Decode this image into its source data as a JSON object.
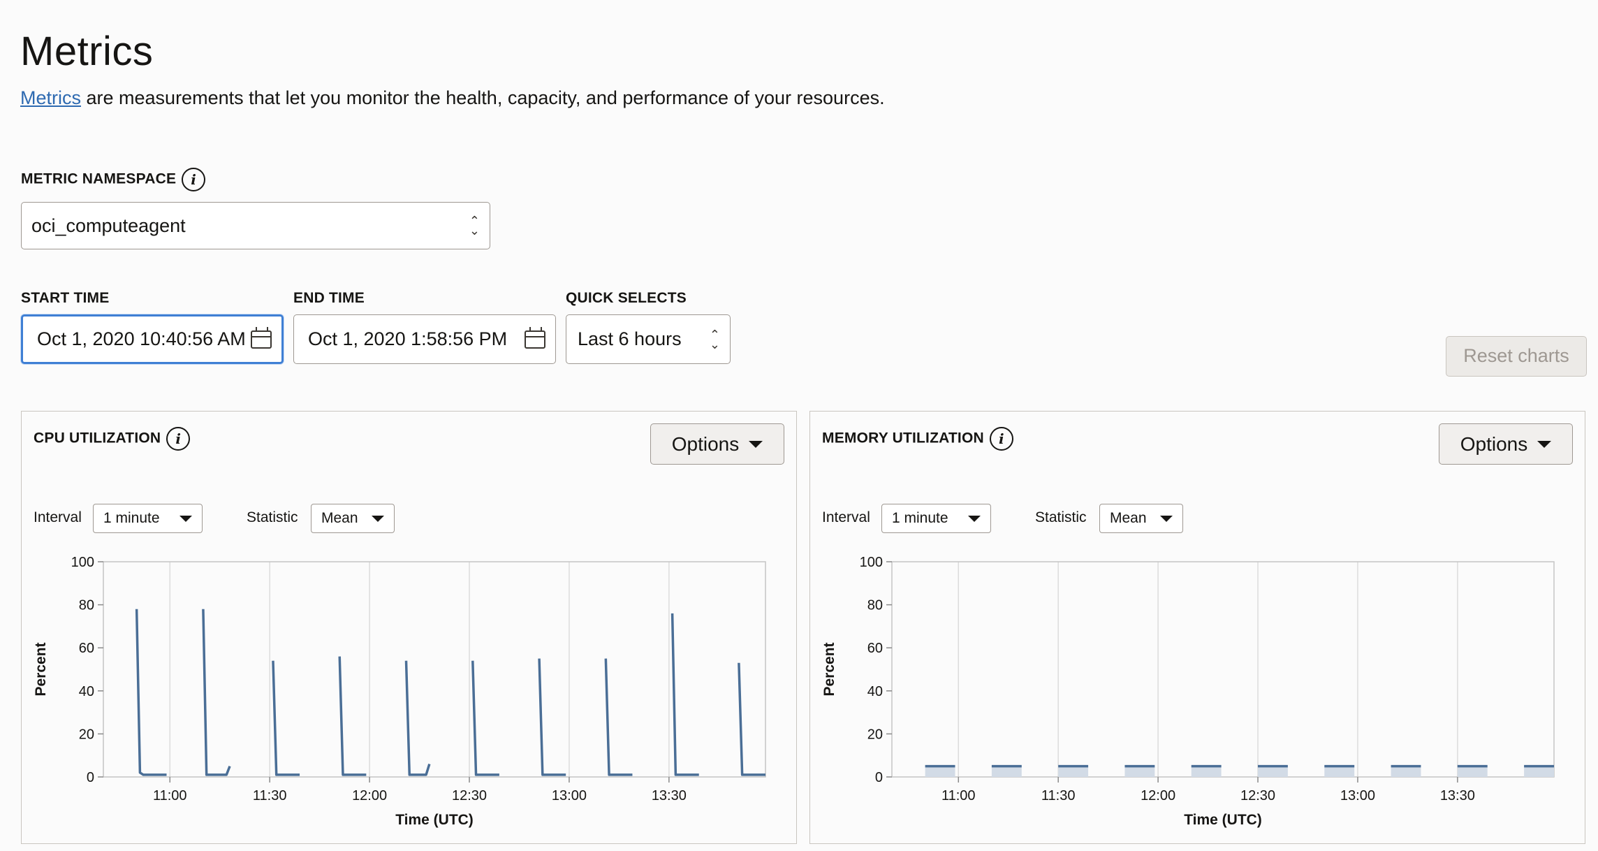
{
  "header": {
    "title": "Metrics",
    "intro_link": "Metrics",
    "intro_rest": " are measurements that let you monitor the health, capacity, and performance of your resources."
  },
  "namespace": {
    "label": "METRIC NAMESPACE",
    "value": "oci_computeagent"
  },
  "time": {
    "start_label": "START TIME",
    "start_value": "Oct 1, 2020 10:40:56 AM",
    "end_label": "END TIME",
    "end_value": "Oct 1, 2020 1:58:56 PM",
    "quick_label": "QUICK SELECTS",
    "quick_value": "Last 6 hours"
  },
  "reset_label": "Reset charts",
  "icons": [
    "info-icon",
    "calendar-icon",
    "chevron-updown-icon",
    "caret-down-icon"
  ],
  "colors": {
    "accent": "#3f7fd4",
    "link": "#2e6ab1",
    "series_line": "#4a6e96",
    "series_fill": "#d2dbe6"
  },
  "panels": [
    {
      "title": "CPU UTILIZATION",
      "options_label": "Options",
      "interval_label": "Interval",
      "interval_value": "1 minute",
      "statistic_label": "Statistic",
      "statistic_value": "Mean"
    },
    {
      "title": "MEMORY UTILIZATION",
      "options_label": "Options",
      "interval_label": "Interval",
      "interval_value": "1 minute",
      "statistic_label": "Statistic",
      "statistic_value": "Mean"
    }
  ],
  "chart_data": [
    {
      "type": "line",
      "title": "CPU UTILIZATION",
      "xlabel": "Time (UTC)",
      "ylabel": "Percent",
      "xlim": [
        "10:40",
        "13:59"
      ],
      "ylim": [
        0,
        100
      ],
      "yticks": [
        0,
        20,
        40,
        60,
        80,
        100
      ],
      "xticks": [
        "11:00",
        "11:30",
        "12:00",
        "12:30",
        "13:00",
        "13:30"
      ],
      "grid": "vertical",
      "series_segments": [
        [
          [
            "10:50",
            78
          ],
          [
            "10:51",
            2
          ],
          [
            "10:52",
            1
          ],
          [
            "10:59",
            1
          ]
        ],
        [
          [
            "11:10",
            78
          ],
          [
            "11:11",
            1
          ],
          [
            "11:12",
            1
          ],
          [
            "11:17",
            1
          ],
          [
            "11:18",
            5
          ]
        ],
        [
          [
            "11:31",
            54
          ],
          [
            "11:32",
            1
          ],
          [
            "11:39",
            1
          ]
        ],
        [
          [
            "11:51",
            56
          ],
          [
            "11:52",
            1
          ],
          [
            "11:59",
            1
          ]
        ],
        [
          [
            "12:11",
            54
          ],
          [
            "12:12",
            1
          ],
          [
            "12:17",
            1
          ],
          [
            "12:18",
            6
          ]
        ],
        [
          [
            "12:31",
            54
          ],
          [
            "12:32",
            1
          ],
          [
            "12:39",
            1
          ]
        ],
        [
          [
            "12:51",
            55
          ],
          [
            "12:52",
            1
          ],
          [
            "12:59",
            1
          ]
        ],
        [
          [
            "13:11",
            55
          ],
          [
            "13:12",
            1
          ],
          [
            "13:19",
            1
          ]
        ],
        [
          [
            "13:31",
            76
          ],
          [
            "13:32",
            1
          ],
          [
            "13:39",
            1
          ]
        ],
        [
          [
            "13:51",
            53
          ],
          [
            "13:52",
            1
          ],
          [
            "13:59",
            1
          ]
        ]
      ]
    },
    {
      "type": "area",
      "title": "MEMORY UTILIZATION",
      "xlabel": "Time (UTC)",
      "ylabel": "Percent",
      "xlim": [
        "10:40",
        "13:59"
      ],
      "ylim": [
        0,
        100
      ],
      "yticks": [
        0,
        20,
        40,
        60,
        80,
        100
      ],
      "xticks": [
        "11:00",
        "11:30",
        "12:00",
        "12:30",
        "13:00",
        "13:30"
      ],
      "grid": "vertical",
      "series_segments": [
        [
          [
            "10:50",
            5
          ],
          [
            "10:59",
            5
          ]
        ],
        [
          [
            "11:10",
            5
          ],
          [
            "11:19",
            5
          ]
        ],
        [
          [
            "11:30",
            5
          ],
          [
            "11:39",
            5
          ]
        ],
        [
          [
            "11:50",
            5
          ],
          [
            "11:59",
            5
          ]
        ],
        [
          [
            "12:10",
            5
          ],
          [
            "12:19",
            5
          ]
        ],
        [
          [
            "12:30",
            5
          ],
          [
            "12:39",
            5
          ]
        ],
        [
          [
            "12:50",
            5
          ],
          [
            "12:59",
            5
          ]
        ],
        [
          [
            "13:10",
            5
          ],
          [
            "13:19",
            5
          ]
        ],
        [
          [
            "13:30",
            5
          ],
          [
            "13:39",
            5
          ]
        ],
        [
          [
            "13:50",
            5
          ],
          [
            "13:59",
            5
          ]
        ]
      ]
    }
  ]
}
